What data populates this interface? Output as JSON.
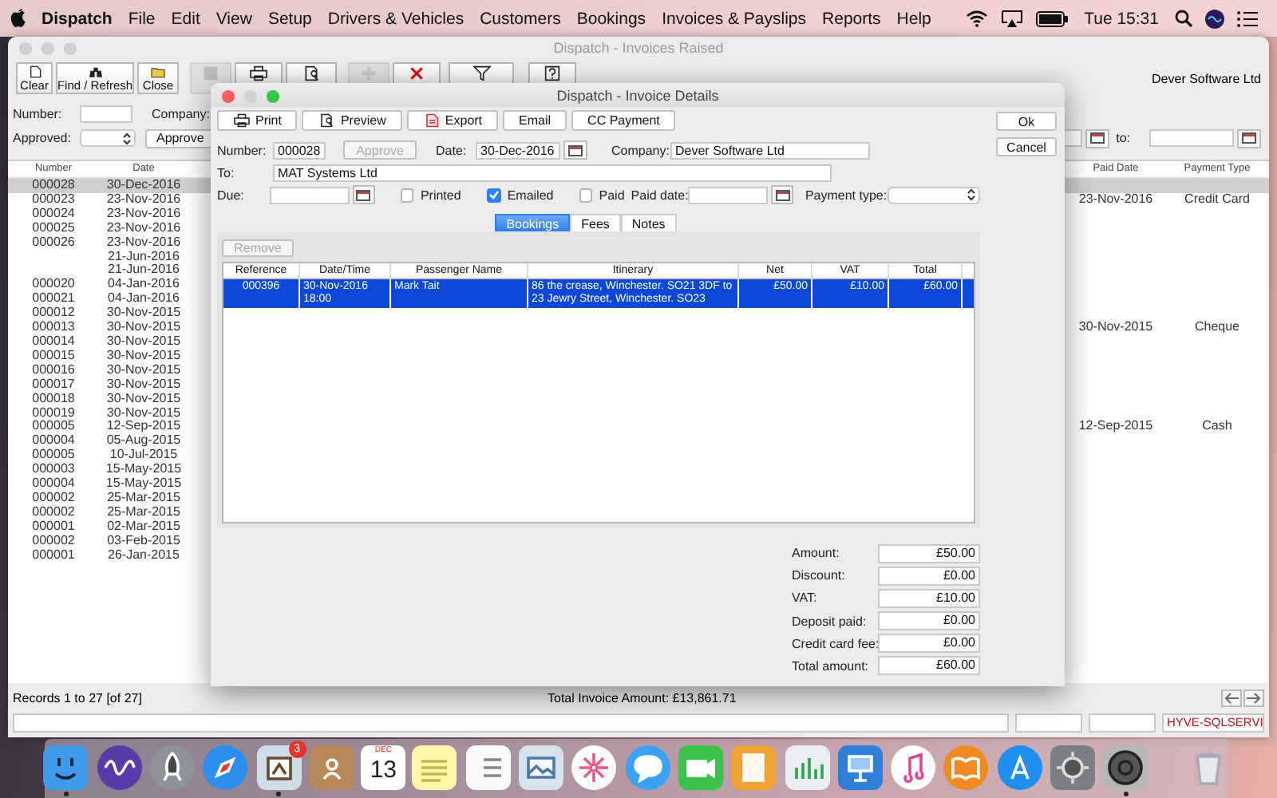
{
  "menubar": {
    "app": "Dispatch",
    "menus": [
      "File",
      "Edit",
      "View",
      "Setup",
      "Drivers & Vehicles",
      "Customers",
      "Bookings",
      "Invoices & Payslips",
      "Reports",
      "Help"
    ],
    "clock": "Tue 15:31"
  },
  "main_window": {
    "title": "Dispatch - Invoices Raised",
    "toolbar": [
      {
        "kind": "new",
        "label": "Clear",
        "disabled": false
      },
      {
        "kind": "find",
        "label": "Find / Refresh",
        "disabled": false
      },
      {
        "kind": "close",
        "label": "Close",
        "disabled": false
      },
      {
        "kind": "save",
        "disabled": true
      },
      {
        "kind": "print",
        "disabled": false
      },
      {
        "kind": "preview",
        "disabled": false
      },
      {
        "kind": "add",
        "disabled": true
      },
      {
        "kind": "delete",
        "disabled": false
      },
      {
        "kind": "filter",
        "disabled": false
      },
      {
        "kind": "help",
        "disabled": false
      }
    ],
    "company": "Dever Software Ltd",
    "filters": {
      "number_label": "Number:",
      "company_label": "Company:",
      "approved_label": "Approved:",
      "approve_button": {
        "label": "Approve",
        "disabled": false
      },
      "to_label": "to:"
    },
    "table": {
      "columns": [
        "Number",
        "Date",
        "Paid Date",
        "Payment Type"
      ],
      "rows": [
        {
          "number": "000028",
          "date": "30-Dec-2016",
          "selected": true
        },
        {
          "number": "000023",
          "date": "23-Nov-2016",
          "paid_date": "23-Nov-2016",
          "payment_type": "Credit Card",
          "selected": false
        },
        {
          "number": "000024",
          "date": "23-Nov-2016",
          "selected": false
        },
        {
          "number": "000025",
          "date": "23-Nov-2016",
          "selected": false
        },
        {
          "number": "000026",
          "date": "23-Nov-2016",
          "selected": false
        },
        {
          "date": "21-Jun-2016",
          "selected": false
        },
        {
          "date": "21-Jun-2016",
          "selected": false
        },
        {
          "number": "000020",
          "date": "04-Jan-2016",
          "selected": false
        },
        {
          "number": "000021",
          "date": "04-Jan-2016",
          "selected": false
        },
        {
          "number": "000012",
          "date": "30-Nov-2015",
          "selected": false
        },
        {
          "number": "000013",
          "date": "30-Nov-2015",
          "paid_date": "30-Nov-2015",
          "payment_type": "Cheque",
          "selected": false
        },
        {
          "number": "000014",
          "date": "30-Nov-2015",
          "selected": false
        },
        {
          "number": "000015",
          "date": "30-Nov-2015",
          "selected": false
        },
        {
          "number": "000016",
          "date": "30-Nov-2015",
          "selected": false
        },
        {
          "number": "000017",
          "date": "30-Nov-2015",
          "selected": false
        },
        {
          "number": "000018",
          "date": "30-Nov-2015",
          "selected": false
        },
        {
          "number": "000019",
          "date": "30-Nov-2015",
          "selected": false
        },
        {
          "number": "000005",
          "date": "12-Sep-2015",
          "paid_date": "12-Sep-2015",
          "payment_type": "Cash",
          "selected": false
        },
        {
          "number": "000004",
          "date": "05-Aug-2015",
          "selected": false
        },
        {
          "number": "000005",
          "date": "10-Jul-2015",
          "selected": false
        },
        {
          "number": "000003",
          "date": "15-May-2015",
          "selected": false
        },
        {
          "number": "000004",
          "date": "15-May-2015",
          "selected": false
        },
        {
          "number": "000002",
          "date": "25-Mar-2015",
          "selected": false
        },
        {
          "number": "000002",
          "date": "25-Mar-2015",
          "selected": false
        },
        {
          "number": "000001",
          "date": "02-Mar-2015",
          "selected": false
        },
        {
          "number": "000002",
          "date": "03-Feb-2015",
          "selected": false
        },
        {
          "number": "000001",
          "date": "26-Jan-2015",
          "selected": false
        }
      ]
    },
    "records": "Records 1 to 27 [of 27]",
    "total": "Total Invoice Amount: £13,861.71",
    "server": "HYVE-SQLSERVI"
  },
  "dialog": {
    "title": "Dispatch - Invoice Details",
    "actions": [
      {
        "kind": "print",
        "label": "Print"
      },
      {
        "kind": "preview",
        "label": "Preview"
      },
      {
        "kind": "export",
        "label": "Export"
      },
      {
        "kind": "plain",
        "label": "Email"
      },
      {
        "kind": "plain",
        "label": "CC Payment"
      }
    ],
    "ok": "Ok",
    "cancel": "Cancel",
    "number_label": "Number:",
    "number": "000028",
    "approve_button": {
      "label": "Approve",
      "disabled": true
    },
    "date_label": "Date:",
    "date": "30-Dec-2016",
    "company_label": "Company:",
    "company": "Dever Software Ltd",
    "to_label": "To:",
    "to": "MAT Systems Ltd",
    "due_label": "Due:",
    "checks": [
      {
        "label": "Printed",
        "checked": false
      },
      {
        "label": "Emailed",
        "checked": true
      },
      {
        "label": "Paid",
        "checked": false
      }
    ],
    "paid_date_label": "Paid date:",
    "payment_type_label": "Payment type:",
    "tabs": [
      {
        "label": "Bookings",
        "selected": true
      },
      {
        "label": "Fees",
        "selected": false
      },
      {
        "label": "Notes",
        "selected": false
      }
    ],
    "remove_button": {
      "label": "Remove",
      "disabled": true
    },
    "bookings": {
      "columns": [
        "Reference",
        "Date/Time",
        "Passenger Name",
        "Itinerary",
        "Net",
        "VAT",
        "Total"
      ],
      "rows": [
        {
          "cells": [
            "000396",
            "30-Nov-2016 18:00",
            "Mark Tait",
            "86 the crease, Winchester. SO21 3DF to 23 Jewry Street, Winchester. SO23",
            "£50.00",
            "£10.00",
            "£60.00"
          ],
          "selected": true
        }
      ]
    },
    "totals": [
      {
        "label": "Amount:",
        "value": "£50.00"
      },
      {
        "label": "Discount:",
        "value": "£0.00"
      },
      {
        "label": "VAT:",
        "value": "£10.00"
      },
      {
        "label": "Deposit paid:",
        "value": "£0.00"
      },
      {
        "label": "Credit card fee:",
        "value": "£0.00"
      },
      {
        "label": "Total amount:",
        "value": "£60.00"
      }
    ]
  },
  "dock": [
    {
      "kind": "finder",
      "running": true
    },
    {
      "kind": "siri",
      "running": false
    },
    {
      "kind": "launchpad",
      "running": false
    },
    {
      "kind": "safari",
      "running": false
    },
    {
      "kind": "mail",
      "running": true,
      "badge": "3"
    },
    {
      "kind": "contacts",
      "running": false
    },
    {
      "kind": "calendar",
      "running": false,
      "month": "DEC",
      "day": "13"
    },
    {
      "kind": "notes",
      "running": false
    },
    {
      "kind": "reminders",
      "running": false
    },
    {
      "kind": "preview",
      "running": false
    },
    {
      "kind": "photos",
      "running": false
    },
    {
      "kind": "messages",
      "running": false
    },
    {
      "kind": "facetime",
      "running": false
    },
    {
      "kind": "pages",
      "running": false
    },
    {
      "kind": "numbers",
      "running": false
    },
    {
      "kind": "keynote",
      "running": false
    },
    {
      "kind": "itunes",
      "running": false
    },
    {
      "kind": "ibooks",
      "running": false
    },
    {
      "kind": "appstore",
      "running": false
    },
    {
      "kind": "settings",
      "running": false
    },
    {
      "kind": "tyre",
      "running": true
    },
    {
      "kind": "trash",
      "running": false
    }
  ]
}
